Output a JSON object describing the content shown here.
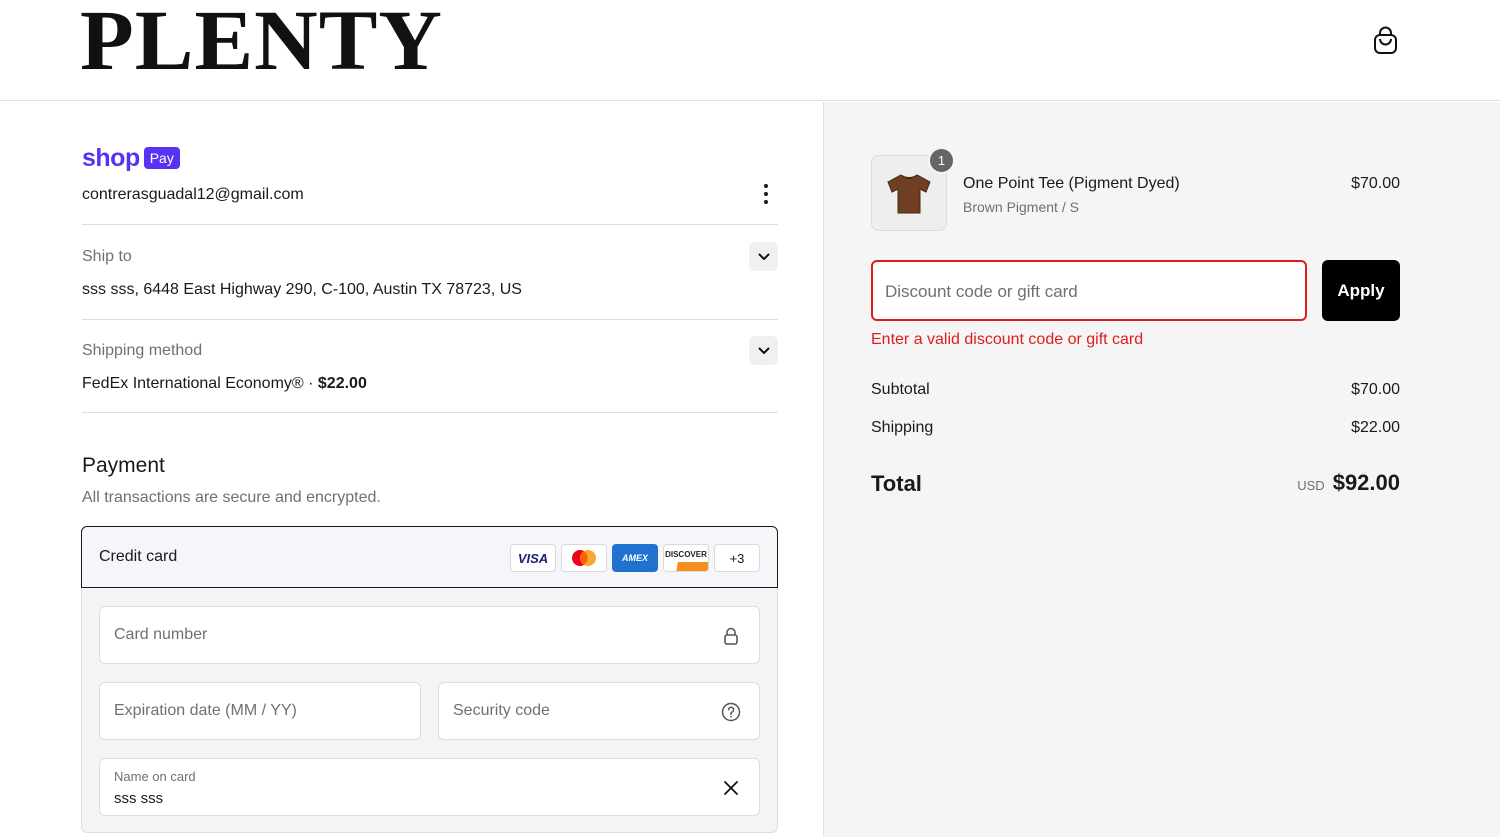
{
  "header": {
    "logo": "PLENTY",
    "cart_icon": "shopping-bag-icon"
  },
  "account": {
    "shop_text": "shop",
    "pay_text": "Pay",
    "email": "contrerasguadal12@gmail.com",
    "menu_icon": "kebab-menu-icon"
  },
  "ship_to": {
    "label": "Ship to",
    "value": "sss sss, 6448 East Highway 290, C-100, Austin TX 78723, US"
  },
  "shipping_method": {
    "label": "Shipping method",
    "value": "FedEx International Economy® ·",
    "price": "$22.00"
  },
  "payment": {
    "title": "Payment",
    "subtitle": "All transactions are secure and encrypted.",
    "method_label": "Credit card",
    "cards": [
      "VISA",
      "mastercard",
      "AMEX",
      "DISCOVER",
      "+3"
    ],
    "card_number_placeholder": "Card number",
    "expiration_placeholder": "Expiration date (MM / YY)",
    "security_placeholder": "Security code",
    "name_label": "Name on card",
    "name_value": "sss sss"
  },
  "summary": {
    "item": {
      "quantity": "1",
      "name": "One Point Tee (Pigment Dyed)",
      "variant": "Brown Pigment / S",
      "price": "$70.00"
    },
    "discount_placeholder": "Discount code or gift card",
    "apply_label": "Apply",
    "error": "Enter a valid discount code or gift card",
    "subtotal_label": "Subtotal",
    "subtotal_value": "$70.00",
    "shipping_label": "Shipping",
    "shipping_value": "$22.00",
    "total_label": "Total",
    "currency": "USD",
    "total_value": "$92.00"
  },
  "colors": {
    "shop_pay": "#5a31f4",
    "error": "#dd1d1d",
    "apply_bg": "#000000"
  }
}
